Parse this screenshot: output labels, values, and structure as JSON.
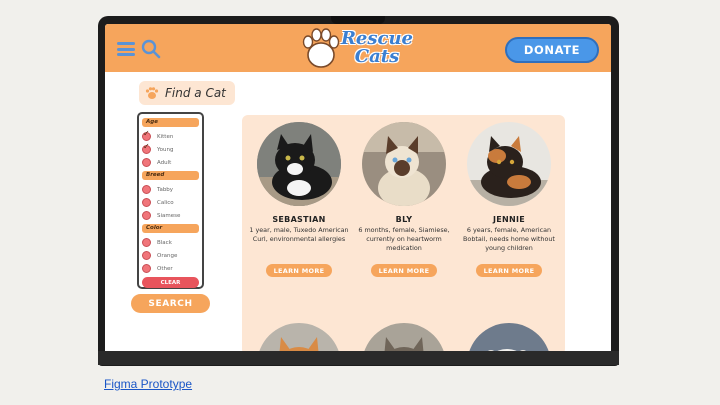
{
  "app": {
    "logo_line1": "Rescue",
    "logo_line2": "Cats",
    "donate_label": "DONATE",
    "hamburger_icon": "hamburger-menu-icon",
    "search_icon": "search-icon"
  },
  "find": {
    "title": "Find a Cat",
    "icon": "paw-icon"
  },
  "filters": {
    "age_heading": "Age",
    "age": [
      {
        "label": "Kitten",
        "checked": true
      },
      {
        "label": "Young",
        "checked": true
      },
      {
        "label": "Adult",
        "checked": false
      }
    ],
    "breed_heading": "Breed",
    "breed": [
      {
        "label": "Tabby",
        "checked": false
      },
      {
        "label": "Calico",
        "checked": false
      },
      {
        "label": "Siamese",
        "checked": false
      }
    ],
    "color_heading": "Color",
    "color": [
      {
        "label": "Black",
        "checked": false
      },
      {
        "label": "Orange",
        "checked": false
      },
      {
        "label": "Other",
        "checked": false
      }
    ],
    "clear_label": "CLEAR",
    "search_label": "SEARCH"
  },
  "cats": [
    {
      "name": "SEBASTIAN",
      "desc": "1 year, male, Tuxedo American Curl, environmental allergies",
      "button": "LEARN MORE"
    },
    {
      "name": "BLY",
      "desc": "6 months, female, Siamiese, currently on heartworm medication",
      "button": "LEARN MORE"
    },
    {
      "name": "JENNIE",
      "desc": "6 years, female, American Bobtail, needs home without young children",
      "button": "LEARN MORE"
    }
  ],
  "caption": "Figma Prototype",
  "colors": {
    "accent": "#f6a55c",
    "blue": "#4a97e8",
    "panel": "#fde6d3",
    "check": "#f0757a"
  }
}
